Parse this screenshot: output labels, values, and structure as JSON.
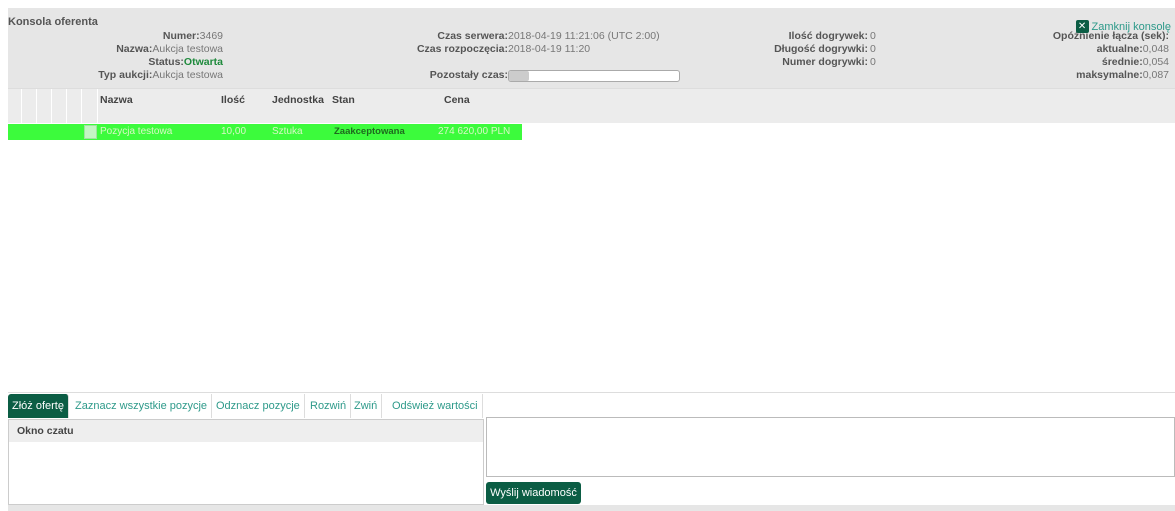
{
  "console": {
    "title": "Konsola oferenta",
    "close_label": "Zamknij konsolę",
    "numer_label": "Numer:",
    "numer": "3469",
    "nazwa_label": "Nazwa:",
    "nazwa": "Aukcja testowa",
    "status_label": "Status:",
    "status": "Otwarta",
    "typ_label": "Typ aukcji:",
    "typ": "Aukcja testowa",
    "czas_serwera_label": "Czas serwera:",
    "czas_serwera": "2018-04-19 11:21:06 (UTC 2:00)",
    "czas_rozpoczecia_label": "Czas rozpoczęcia:",
    "czas_rozpoczecia": "2018-04-19 11:20",
    "pozostaly_label": "Pozostały czas:",
    "pozostaly_progress": 0.12,
    "ilosc_dogrywek_label": "Ilość dogrywek:",
    "ilosc_dogrywek": "0",
    "dlugosc_label": "Długość dogrywki:",
    "dlugosc": "0",
    "numer_dogrywki_label": "Numer dogrywki:",
    "numer_dogrywki": "0",
    "opoznienie_label": "Opóźnienie łącza (sek):",
    "aktualne_label": "aktualne:",
    "aktualne": "0,048",
    "srednie_label": "średnie:",
    "srednie": "0,054",
    "maksymalne_label": "maksymalne:",
    "maksymalne": "0,087"
  },
  "table": {
    "columns": [
      "Nazwa",
      "Ilość",
      "Jednostka",
      "Stan",
      "Cena"
    ],
    "rows": [
      {
        "nazwa": "Pozycja testowa",
        "ilosc": "10,00",
        "jednostka": "Sztuka",
        "stan": "Zaakceptowana",
        "cena": "274 620,00 PLN"
      }
    ],
    "row_color": "#3cfb3c"
  },
  "toolbar": {
    "zloz": "Złóż ofertę",
    "zaznacz": "Zaznacz wszystkie pozycje",
    "odznacz": "Odznacz pozycje",
    "rozwin": "Rozwiń",
    "zwin": "Zwiń",
    "odswiez": "Odśwież wartości"
  },
  "chat": {
    "title": "Okno czatu",
    "send": "Wyślij wiadomość",
    "message": ""
  },
  "colors": {
    "accent": "#0b5d44",
    "link": "#2e9a8a",
    "status_green": "#1e8a3c"
  }
}
